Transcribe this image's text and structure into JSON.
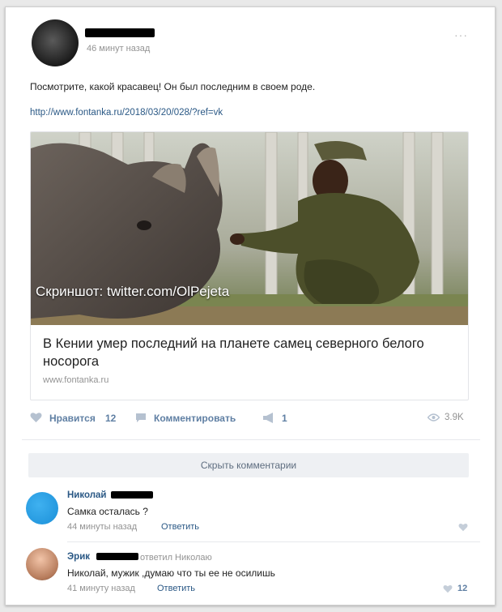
{
  "post": {
    "time": "46 минут назад",
    "more": "···",
    "text": "Посмотрите, какой красавец! Он был последним в своем роде.",
    "link": "http://www.fontanka.ru/2018/03/20/028/?ref=vk"
  },
  "card": {
    "caption": "Скриншот: twitter.com/OlPejeta",
    "title": "В Кении умер последний на планете самец северного белого носорога",
    "domain": "www.fontanka.ru"
  },
  "actions": {
    "like_label": "Нравится",
    "like_count": "12",
    "comment_label": "Комментировать",
    "share_count": "1",
    "views": "3.9K"
  },
  "comments": {
    "hide_label": "Скрыть комментарии",
    "items": [
      {
        "name": "Николай",
        "text": "Самка осталась ?",
        "meta": "44 минуты назад",
        "reply": "Ответить"
      },
      {
        "name": "Эрик",
        "reply_to": "ответил Николаю",
        "text": "Николай, мужик ,думаю что ты ее не осилишь",
        "meta": "41 минуту назад",
        "reply": "Ответить",
        "likes": "12"
      }
    ]
  },
  "colors": {
    "link": "#2a5885",
    "muted": "#939393",
    "action": "#5f7fa3",
    "comment_avatar_1": "#1a8fd8"
  },
  "icons": [
    "heart-icon",
    "comment-icon",
    "share-icon",
    "eye-icon"
  ]
}
